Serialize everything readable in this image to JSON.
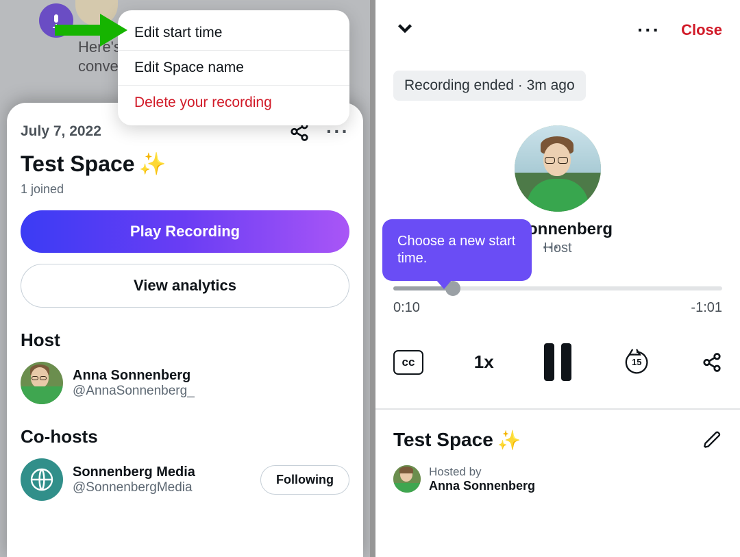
{
  "left": {
    "bg": {
      "line1": "Here's",
      "line2": "conver"
    },
    "popup": {
      "item1": "Edit start time",
      "item2": "Edit Space name",
      "item3": "Delete your recording"
    },
    "sheet": {
      "date": "July 7, 2022",
      "title": "Test Space",
      "sparkle": "✨",
      "joined": "1 joined",
      "play_btn": "Play Recording",
      "analytics_btn": "View analytics",
      "host_section": "Host",
      "host": {
        "name": "Anna Sonnenberg",
        "handle": "@AnnaSonnenberg_"
      },
      "cohost_section": "Co-hosts",
      "cohost": {
        "name": "Sonnenberg Media",
        "handle": "@SonnenbergMedia",
        "follow": "Following"
      }
    }
  },
  "right": {
    "close": "Close",
    "status": "Recording ended · 3m ago",
    "center_name": "a Sonnenberg",
    "center_role": "Host",
    "tooltip": "Choose a new start time.",
    "time_current": "0:10",
    "time_remaining": "-1:01",
    "cc": "cc",
    "speed": "1x",
    "skip": "15",
    "detail_title": "Test Space",
    "detail_sparkle": "✨",
    "hosted_by_label": "Hosted by",
    "hosted_by_name": "Anna Sonnenberg"
  }
}
